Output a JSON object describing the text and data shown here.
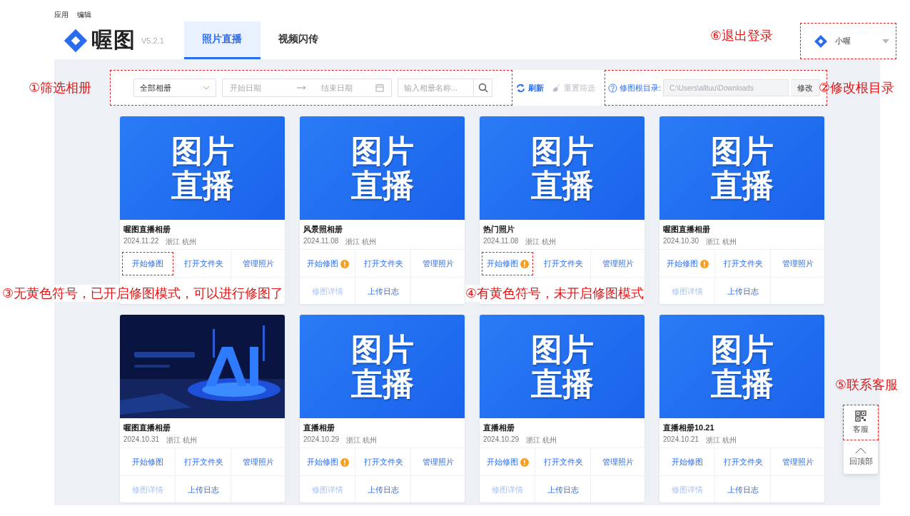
{
  "menu_bar": [
    "应用",
    "编辑"
  ],
  "header": {
    "brand": "喔图",
    "version": "V5.2.1",
    "tabs": [
      {
        "label": "照片直播",
        "selected": true
      },
      {
        "label": "视频闪传",
        "selected": false
      }
    ],
    "user": {
      "name": "小喔"
    }
  },
  "toolbar": {
    "album_select": {
      "value": "全部相册"
    },
    "date_range": {
      "start_placeholder": "开始日期",
      "end_placeholder": "结束日期"
    },
    "search": {
      "placeholder": "输入相册名称..."
    },
    "refresh": {
      "label": "刷新",
      "disabled": false
    },
    "reset": {
      "label": "重置筛选",
      "disabled": true
    },
    "root_dir": {
      "label": "修图根目录:",
      "value": "C:\\Users\\alltuu\\Downloads",
      "button": "修改"
    }
  },
  "albums": [
    {
      "cover": {
        "kind": "text",
        "lines": [
          "图片",
          "直播"
        ]
      },
      "title": "喔图直播相册",
      "date": "2024.11.22",
      "location": "浙江 杭州",
      "retouch_mode_on": true,
      "actions": [
        "开始修图",
        "打开文件夹",
        "管理照片"
      ],
      "highlight_start": true
    },
    {
      "cover": {
        "kind": "text",
        "lines": [
          "图片",
          "直播"
        ]
      },
      "title": "风景照相册",
      "date": "2024.11.08",
      "location": "浙江 杭州",
      "retouch_mode_on": false,
      "actions": [
        "开始修图",
        "打开文件夹",
        "管理照片"
      ],
      "more_actions": [
        "修图详情",
        "上传日志"
      ],
      "highlight_start": false
    },
    {
      "cover": {
        "kind": "text",
        "lines": [
          "图片",
          "直播"
        ]
      },
      "title": "热门照片",
      "date": "2024.11.08",
      "location": "浙江 杭州",
      "retouch_mode_on": false,
      "actions": [
        "开始修图",
        "打开文件夹",
        "管理照片"
      ],
      "highlight_start": true
    },
    {
      "cover": {
        "kind": "text",
        "lines": [
          "图片",
          "直播"
        ]
      },
      "title": "喔图直播相册",
      "date": "2024.10.30",
      "location": "浙江 杭州",
      "retouch_mode_on": false,
      "actions": [
        "开始修图",
        "打开文件夹",
        "管理照片"
      ],
      "more_actions": [
        "修图详情",
        "上传日志"
      ],
      "highlight_start": false
    },
    {
      "cover": {
        "kind": "picture"
      },
      "title": "喔图直播相册",
      "date": "2024.10.31",
      "location": "浙江 杭州",
      "retouch_mode_on": true,
      "actions": [
        "开始修图",
        "打开文件夹",
        "管理照片"
      ],
      "more_actions": [
        "修图详情",
        "上传日志"
      ],
      "highlight_start": false
    },
    {
      "cover": {
        "kind": "text",
        "lines": [
          "图片",
          "直播"
        ]
      },
      "title": "直播相册",
      "date": "2024.10.29",
      "location": "浙江 杭州",
      "retouch_mode_on": false,
      "actions": [
        "开始修图",
        "打开文件夹",
        "管理照片"
      ],
      "more_actions": [
        "修图详情",
        "上传日志"
      ],
      "highlight_start": false
    },
    {
      "cover": {
        "kind": "text",
        "lines": [
          "图片",
          "直播"
        ]
      },
      "title": "直播相册",
      "date": "2024.10.29",
      "location": "浙江 杭州",
      "retouch_mode_on": false,
      "actions": [
        "开始修图",
        "打开文件夹",
        "管理照片"
      ],
      "more_actions": [
        "修图详情",
        "上传日志"
      ],
      "highlight_start": false
    },
    {
      "cover": {
        "kind": "text",
        "lines": [
          "图片",
          "直播"
        ]
      },
      "title": "直播相册10.21",
      "date": "2024.10.21",
      "location": "浙江 杭州",
      "retouch_mode_on": true,
      "actions": [
        "开始修图",
        "打开文件夹",
        "管理照片"
      ],
      "more_actions": [
        "修图详情",
        "上传日志"
      ],
      "highlight_start": false
    }
  ],
  "float_panel": {
    "service": "客服",
    "back_top": "回顶部"
  },
  "annotations": {
    "filter": "①筛选相册",
    "root_dir": "②修改根目录",
    "no_mark": "③无黄色符号，已开启修图模式，可以进行修图了",
    "mark": "④有黄色符号，未开启修图模式",
    "service": "⑤联系客服",
    "logout": "⑥退出登录"
  }
}
